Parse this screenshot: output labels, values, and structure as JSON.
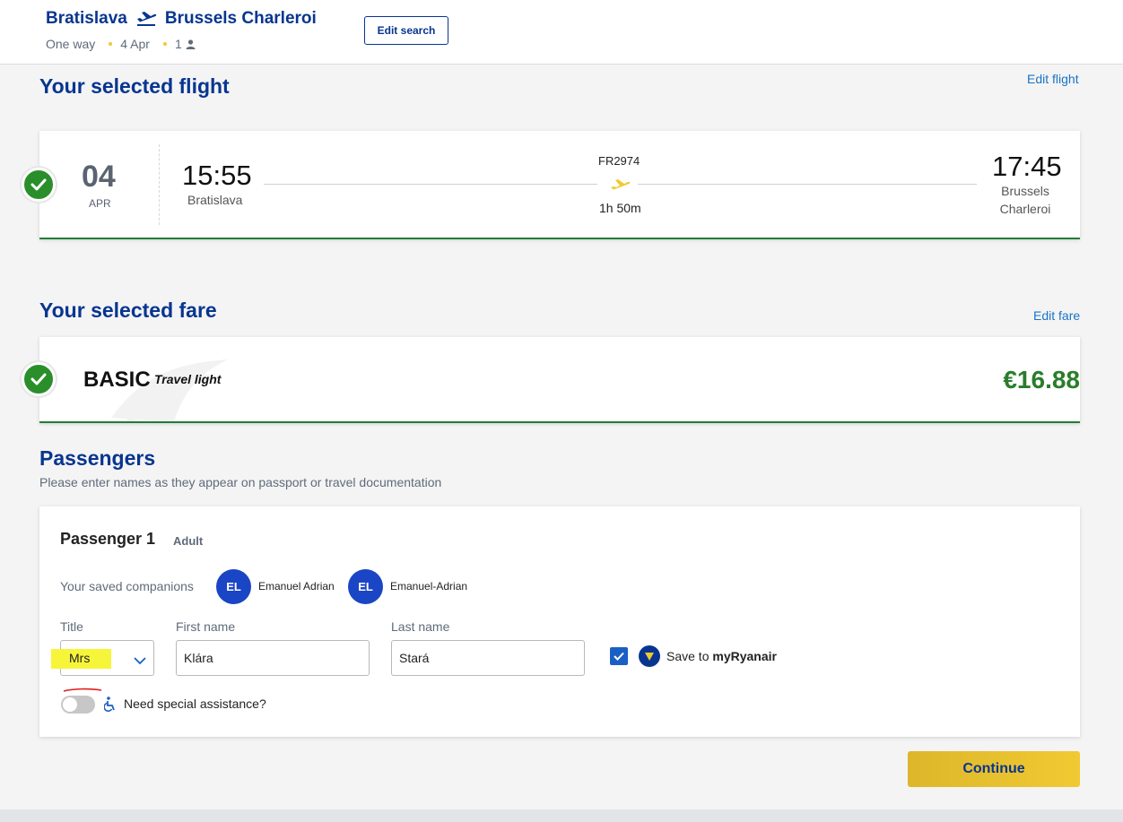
{
  "header": {
    "origin": "Bratislava",
    "destination": "Brussels Charleroi",
    "trip_type": "One way",
    "date": "4 Apr",
    "passenger_count": "1",
    "edit_search_label": "Edit search",
    "plane_icon": "plane-departure-icon",
    "person_icon": "person-icon"
  },
  "flight_section": {
    "title": "Your selected flight",
    "edit_label": "Edit flight",
    "day": "04",
    "month": "APR",
    "departure_time": "15:55",
    "departure_city": "Bratislava",
    "flight_number": "FR2974",
    "duration": "1h 50m",
    "arrival_time": "17:45",
    "arrival_city_line1": "Brussels",
    "arrival_city_line2": "Charleroi"
  },
  "fare_section": {
    "title": "Your selected fare",
    "edit_label": "Edit fare",
    "fare_name": "BASIC",
    "fare_subtitle": "Travel light",
    "price": "€16.88"
  },
  "passengers": {
    "title": "Passengers",
    "note": "Please enter names as they appear on passport or travel documentation",
    "passenger_title": "Passenger 1",
    "passenger_type": "Adult",
    "companions_label": "Your saved companions",
    "companions": [
      {
        "initials": "EL",
        "name": "Emanuel Adrian"
      },
      {
        "initials": "EL",
        "name": "Emanuel-Adrian"
      }
    ],
    "title_label": "Title",
    "title_value": "Mrs",
    "first_name_label": "First name",
    "first_name_value": "Klára",
    "last_name_label": "Last name",
    "last_name_value": "Stará",
    "save_checked": true,
    "save_prefix": "Save to ",
    "save_brand": "myRyanair",
    "assist_label": "Need special assistance?",
    "assist_on": false
  },
  "continue_label": "Continue",
  "colors": {
    "brand_blue": "#073590",
    "link_blue": "#1a73c7",
    "success_green": "#2a8f2a",
    "accent_yellow": "#f1c933"
  }
}
